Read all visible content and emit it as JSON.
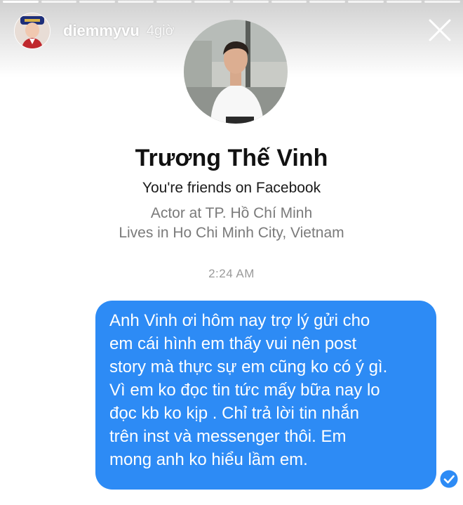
{
  "story": {
    "username": "diemmyvu",
    "time_ago": "4giờ",
    "progress_segments": 12,
    "progress_done": 1
  },
  "profile": {
    "name": "Trương Thế Vinh",
    "friends": "You're friends on Facebook",
    "work": "Actor at TP. Hồ Chí Minh",
    "lives": "Lives in Ho Chi Minh City, Vietnam"
  },
  "chat": {
    "time": "2:24 AM",
    "message_lines": [
      "Anh Vinh ơi hôm nay trợ lý gửi cho",
      "em cái hình em thấy vui nên post",
      "story mà thực sự em cũng ko có ý gì.",
      "Vì em ko đọc tin tức mấy bữa nay lo",
      "đọc kb ko kịp . Chỉ trả lời tin nhắn",
      "trên inst và messenger thôi. Em",
      "mong anh ko hiểu lầm em."
    ]
  },
  "colors": {
    "bubble": "#2d8bf5",
    "seen": "#2d8bf5"
  },
  "icons": {
    "close": "close-icon",
    "seen": "seen-check-icon"
  }
}
